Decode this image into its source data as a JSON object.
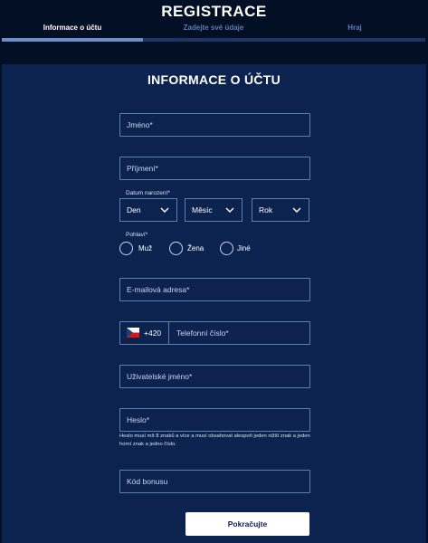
{
  "header": {
    "title": "REGISTRACE",
    "steps": [
      {
        "label": "Informace o účtu",
        "active": true
      },
      {
        "label": "Zadejte své údaje",
        "active": false
      },
      {
        "label": "Hraj",
        "active": false
      }
    ]
  },
  "form": {
    "section_title": "INFORMACE O ÚČTU",
    "first_name_placeholder": "Jméno*",
    "last_name_placeholder": "Příjmení*",
    "birthdate": {
      "label": "Datum narození*",
      "day": "Den",
      "month": "Měsíc",
      "year": "Rok"
    },
    "gender": {
      "label": "Pohlaví*",
      "options": [
        "Muž",
        "Žena",
        "Jiné"
      ]
    },
    "email_placeholder": "E-mailová adresa*",
    "phone": {
      "flag": "czech-flag",
      "prefix": "+420",
      "placeholder": "Telefonní číslo*"
    },
    "username_placeholder": "Uživatelské jméno*",
    "password_placeholder": "Heslo*",
    "password_hint": "Heslo musí mít 8 znaků a více a musí obsahovat alespoň jeden nižší znak a jeden horní znak a jedno číslo.",
    "bonus_placeholder": "Kód bonusu",
    "continue_label": "Pokračujte"
  },
  "colors": {
    "background": "#030f24",
    "panel": "#0c2350",
    "border": "#5f7fb3",
    "button": "#ffffff"
  }
}
